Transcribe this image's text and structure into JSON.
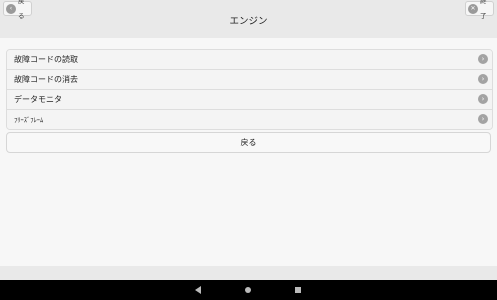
{
  "header": {
    "back_label": "戻る",
    "exit_label": "終了",
    "title": "エンジン"
  },
  "menu": {
    "items": [
      {
        "label": "故障コードの読取"
      },
      {
        "label": "故障コードの消去"
      },
      {
        "label": "データモニタ"
      },
      {
        "label": "ﾌﾘｰｽﾞﾌﾚｰﾑ"
      }
    ]
  },
  "back_button_label": "戻る",
  "icons": {
    "chevron": "›",
    "back": "‹",
    "exit": "✕"
  },
  "colors": {
    "header_bg": "#e9e9e9",
    "page_bg": "#f7f7f7",
    "navbar_bg": "#000000"
  }
}
